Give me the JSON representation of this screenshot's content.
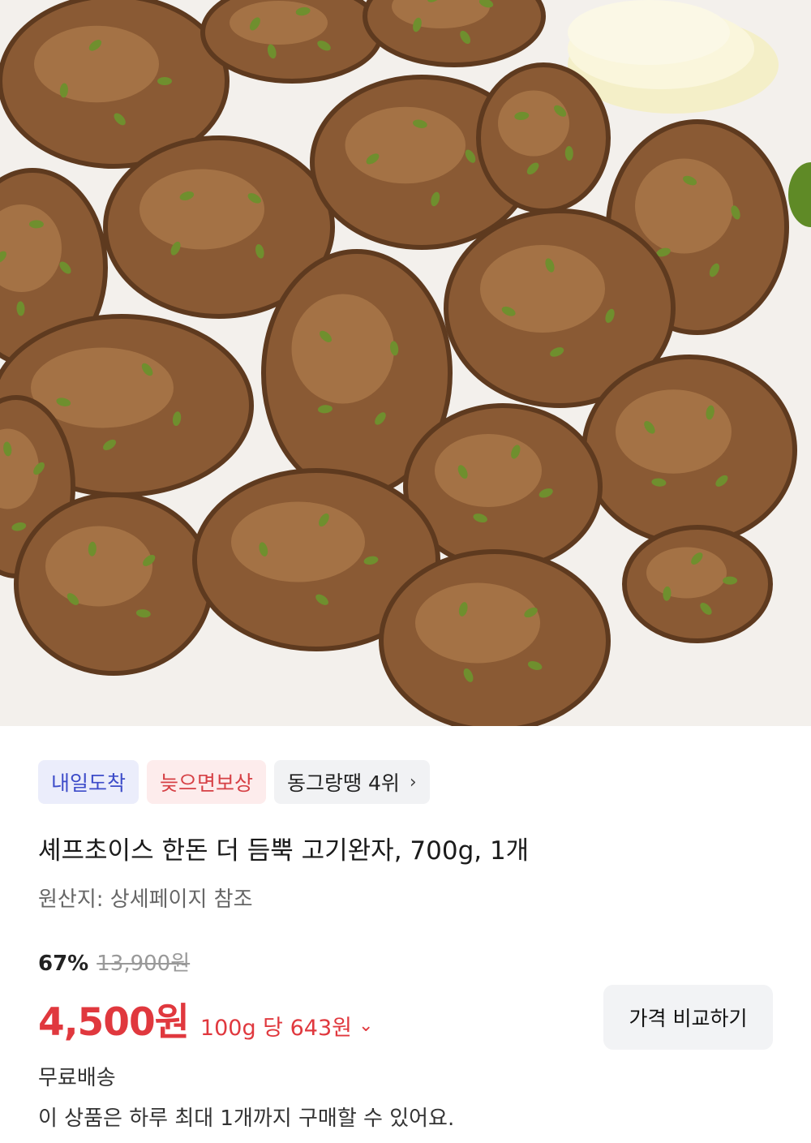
{
  "product_image": {
    "alt": "고기완자",
    "colors": {
      "background": "#f1eeea",
      "meat": "#8a5a34",
      "meat_dark": "#5e3a1f",
      "highlight": "#b98654",
      "herb": "#6f8f2e"
    }
  },
  "badges": [
    {
      "label": "내일도착",
      "style": "blue"
    },
    {
      "label": "늦으면보상",
      "style": "red"
    },
    {
      "label": "동그랑땡 4위",
      "style": "gray",
      "icon": "chevron-right-icon"
    }
  ],
  "product": {
    "title": "셰프초이스 한돈 더 듬뿍 고기완자, 700g, 1개",
    "origin": "원산지: 상세페이지 참조"
  },
  "pricing": {
    "discount": "67%",
    "original_price": "13,900원",
    "sale_price": "4,500원",
    "unit_price": "100g 당 643원",
    "unit_price_icon": "chevron-down-icon",
    "compare_label": "가격 비교하기",
    "accent_color": "#e0383e"
  },
  "shipping": {
    "label": "무료배송",
    "purchase_limit": "이 상품은 하루 최대 1개까지 구매할 수 있어요."
  }
}
